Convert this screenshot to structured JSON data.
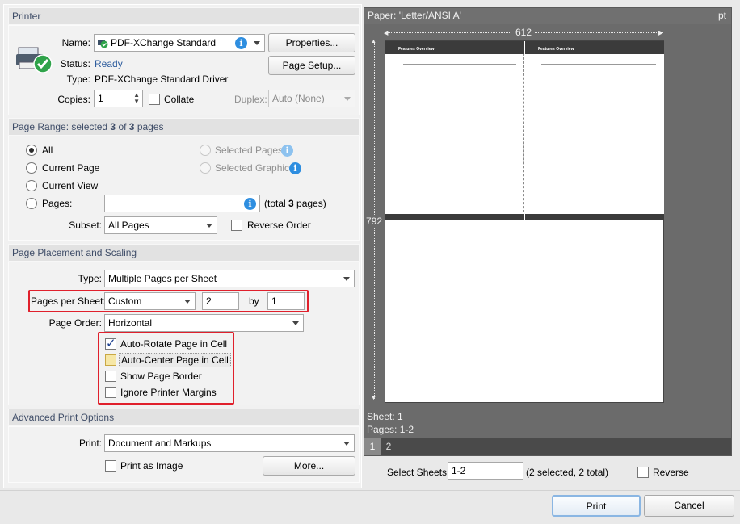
{
  "printer": {
    "title": "Printer",
    "name_label": "Name:",
    "name_value": "PDF-XChange Standard",
    "properties_button": "Properties...",
    "page_setup_button": "Page Setup...",
    "status_label": "Status:",
    "status_value": "Ready",
    "type_label": "Type:",
    "type_value": "PDF-XChange Standard Driver",
    "copies_label": "Copies:",
    "copies_value": "1",
    "collate_label": "Collate",
    "duplex_label": "Duplex:",
    "duplex_value": "Auto (None)"
  },
  "page_range": {
    "title_prefix": "Page Range: selected ",
    "title_selected": "3",
    "title_mid": " of ",
    "title_total": "3",
    "title_suffix": " pages",
    "all": "All",
    "current_page": "Current Page",
    "current_view": "Current View",
    "pages": "Pages:",
    "pages_value": "",
    "total_prefix": "(total ",
    "total_count": "3",
    "total_suffix": " pages)",
    "selected_pages": "Selected Pages",
    "selected_graphic": "Selected Graphic",
    "subset_label": "Subset:",
    "subset_value": "All Pages",
    "reverse_order": "Reverse Order"
  },
  "placement": {
    "title": "Page Placement and Scaling",
    "type_label": "Type:",
    "type_value": "Multiple Pages per Sheet",
    "pps_label": "Pages per Sheet:",
    "pps_value": "Custom",
    "pps_x": "2",
    "by_label": "by",
    "pps_y": "1",
    "order_label": "Page Order:",
    "order_value": "Horizontal",
    "auto_rotate": "Auto-Rotate Page in Cell",
    "auto_center": "Auto-Center Page in Cell",
    "show_border": "Show Page Border",
    "ignore_margins": "Ignore Printer Margins"
  },
  "advanced": {
    "title": "Advanced Print Options",
    "print_label": "Print:",
    "print_value": "Document and Markups",
    "print_as_image": "Print as Image",
    "more_button": "More..."
  },
  "preview": {
    "paper_title": "Paper: 'Letter/ANSI A'",
    "unit": "pt",
    "width_value": "612",
    "height_value": "792",
    "page_header_left": "Features Overview",
    "page_header_right": "Features Overview",
    "sheet_label": "Sheet: 1",
    "pages_label": "Pages: 1-2",
    "tab_1": "1",
    "tab_2": "2",
    "select_sheets_label": "Select Sheets:",
    "select_sheets_value": "1-2",
    "select_sheets_info": "(2 selected, 2 total)",
    "reverse_label": "Reverse"
  },
  "footer": {
    "print_button": "Print",
    "cancel_button": "Cancel"
  },
  "colors": {
    "accent": "#2e5d9e",
    "highlight_red": "#e0202c",
    "preview_dark": "#6a6a6a"
  }
}
